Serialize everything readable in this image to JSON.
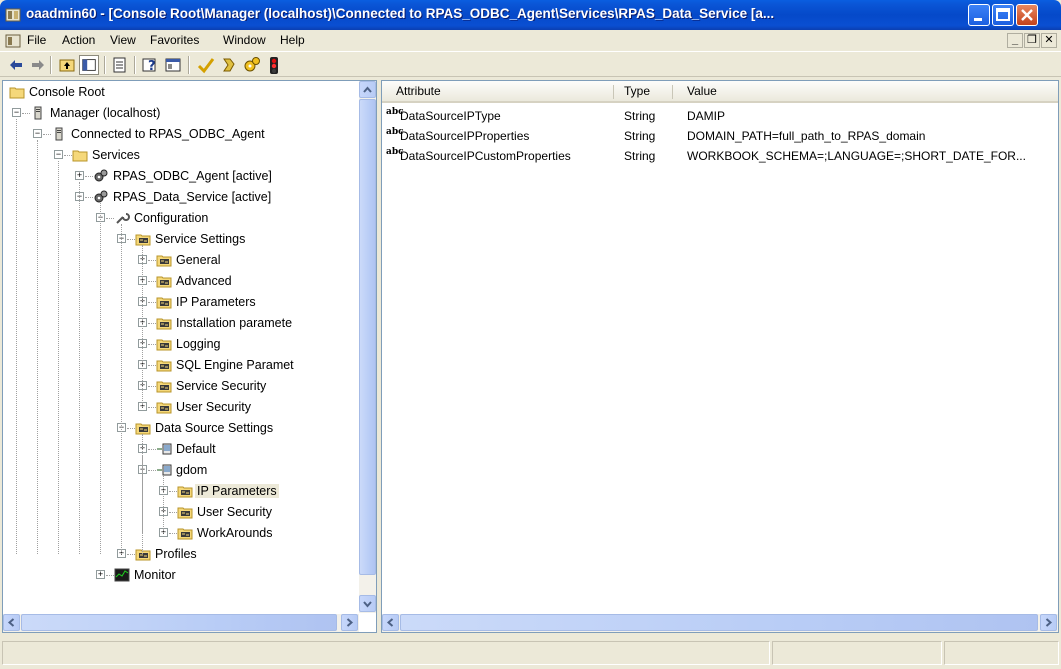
{
  "window": {
    "title": "oaadmin60 - [Console Root\\Manager (localhost)\\Connected to RPAS_ODBC_Agent\\Services\\RPAS_Data_Service [a...",
    "accent": "#0a4fd2"
  },
  "menu": {
    "items": [
      "File",
      "Action",
      "View",
      "Favorites",
      "Window",
      "Help"
    ],
    "mdi": [
      "_",
      "❐",
      "✕"
    ]
  },
  "toolbar": {
    "icons": [
      "back-icon",
      "forward-icon",
      "up-folder-icon",
      "show-tree-icon",
      "export-list-icon",
      "help-icon",
      "console-window-icon",
      "check-icon",
      "undo-icon",
      "settings-gears-icon",
      "traffic-light-icon"
    ]
  },
  "tree": [
    {
      "label": "Console Root",
      "icon": "folder-icon"
    },
    {
      "label": "Manager (localhost)",
      "icon": "server-icon"
    },
    {
      "label": "Connected to RPAS_ODBC_Agent",
      "icon": "server-icon"
    },
    {
      "label": "Services",
      "icon": "folder-icon"
    },
    {
      "label": "RPAS_ODBC_Agent [active]",
      "icon": "service-gear-icon"
    },
    {
      "label": "RPAS_Data_Service [active]",
      "icon": "service-gear-icon"
    },
    {
      "label": "Configuration",
      "icon": "wrench-icon"
    },
    {
      "label": "Service Settings",
      "icon": "settings-folder-icon"
    },
    {
      "label": "General",
      "icon": "settings-folder-icon"
    },
    {
      "label": "Advanced",
      "icon": "settings-folder-icon"
    },
    {
      "label": "IP Parameters",
      "icon": "settings-folder-icon"
    },
    {
      "label": "Installation paramete",
      "icon": "settings-folder-icon"
    },
    {
      "label": "Logging",
      "icon": "settings-folder-icon"
    },
    {
      "label": "SQL Engine Paramet",
      "icon": "settings-folder-icon"
    },
    {
      "label": "Service Security",
      "icon": "settings-folder-icon"
    },
    {
      "label": "User Security",
      "icon": "settings-folder-icon"
    },
    {
      "label": "Data Source Settings",
      "icon": "settings-folder-icon"
    },
    {
      "label": "Default",
      "icon": "datasource-icon"
    },
    {
      "label": "gdom",
      "icon": "datasource-icon"
    },
    {
      "label": "IP Parameters",
      "icon": "settings-folder-icon"
    },
    {
      "label": "User Security",
      "icon": "settings-folder-icon"
    },
    {
      "label": "WorkArounds",
      "icon": "settings-folder-icon"
    },
    {
      "label": "Profiles",
      "icon": "settings-folder-icon"
    },
    {
      "label": "Monitor",
      "icon": "monitor-icon"
    }
  ],
  "list": {
    "columns": [
      "Attribute",
      "Type",
      "Value"
    ],
    "rows": [
      {
        "attribute": "DataSourceIPType",
        "type": "String",
        "value": "DAMIP"
      },
      {
        "attribute": "DataSourceIPProperties",
        "type": "String",
        "value": "DOMAIN_PATH=full_path_to_RPAS_domain"
      },
      {
        "attribute": "DataSourceIPCustomProperties",
        "type": "String",
        "value": "WORKBOOK_SCHEMA=;LANGUAGE=;SHORT_DATE_FOR..."
      }
    ],
    "type_icon_label": "abc"
  }
}
